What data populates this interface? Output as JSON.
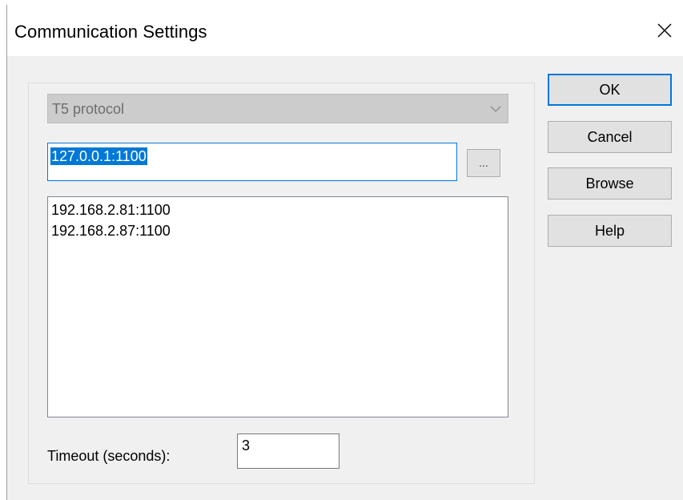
{
  "window": {
    "title": "Communication Settings"
  },
  "protocol": {
    "selected": "T5 protocol"
  },
  "address": {
    "value": "127.0.0.1:1100"
  },
  "ellipsis_label": "...",
  "address_list": {
    "items": [
      "192.168.2.81:1100",
      "192.168.2.87:1100"
    ]
  },
  "timeout": {
    "label": "Timeout (seconds):",
    "value": "3"
  },
  "buttons": {
    "ok": "OK",
    "cancel": "Cancel",
    "browse": "Browse",
    "help": "Help"
  },
  "colors": {
    "accent": "#0078d7",
    "dialog_bg": "#f0f0f0",
    "button_bg": "#e1e1e1",
    "disabled_combo_bg": "#cccccc"
  },
  "icons": {
    "close": "close-icon",
    "dropdown": "chevron-down-icon"
  }
}
